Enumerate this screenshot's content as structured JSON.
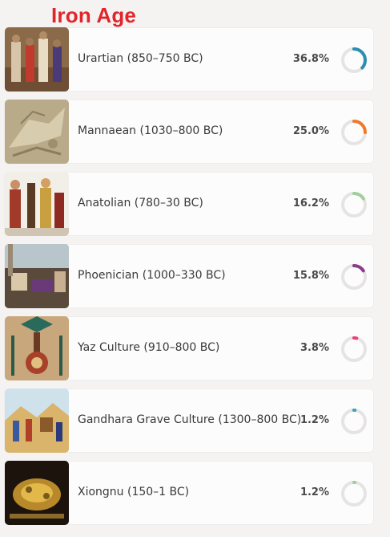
{
  "page": {
    "title": "Iron Age"
  },
  "items": [
    {
      "label": "Urartian (850–750 BC)",
      "percent_text": "36.8%",
      "percent": 36.8,
      "color": "#2a8fb0",
      "image": "urartian-artwork"
    },
    {
      "label": "Mannaean (1030–800 BC)",
      "percent_text": "25.0%",
      "percent": 25.0,
      "color": "#f07a2a",
      "image": "mannaean-relief"
    },
    {
      "label": "Anatolian (780–30 BC)",
      "percent_text": "16.2%",
      "percent": 16.2,
      "color": "#9fd09a",
      "image": "anatolian-warriors"
    },
    {
      "label": "Phoenician (1000–330 BC)",
      "percent_text": "15.8%",
      "percent": 15.8,
      "color": "#8e3a8e",
      "image": "phoenician-scene"
    },
    {
      "label": "Yaz Culture (910–800 BC)",
      "percent_text": "3.8%",
      "percent": 3.8,
      "color": "#e8407a",
      "image": "yaz-textile"
    },
    {
      "label": "Gandhara Grave Culture (1300–800 BC)",
      "percent_text": "1.2%",
      "percent": 1.2,
      "color": "#3aa6b0",
      "image": "gandhara-procession"
    },
    {
      "label": "Xiongnu (150–1 BC)",
      "percent_text": "1.2%",
      "percent": 1.2,
      "color": "#9fd09a",
      "image": "xiongnu-gold"
    }
  ]
}
